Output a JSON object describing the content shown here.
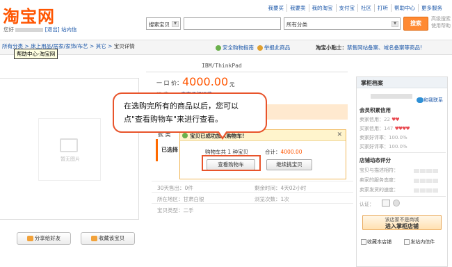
{
  "header": {
    "logo": "淘宝网",
    "nav": [
      "我要买",
      "我要卖",
      "我的淘宝",
      "支付宝",
      "社区",
      "打听",
      "帮助中心",
      "更多服务"
    ],
    "greeting": "您好",
    "logout": "[退出]",
    "messages": "站内信"
  },
  "search": {
    "scope": "搜索宝贝",
    "category": "所有分类",
    "button": "搜索",
    "advanced": "高级搜索\n使用帮助"
  },
  "breadcrumb": {
    "items": [
      "所有分类",
      "床上用品/居家/家饰/布艺",
      "其它",
      "宝贝详情"
    ],
    "tooltip": "帮助中心-淘宝网"
  },
  "guide": {
    "safe": "安全购物指南",
    "report": "举报此商品"
  },
  "tips": {
    "label": "淘宝小贴士：",
    "text": "禁售网站备案、域名备案等商品!"
  },
  "product": {
    "title": "IBM/ThinkPad",
    "price_label": "一 口 价：",
    "price": "4000.00",
    "unit": "元",
    "freight_label": "运      费：",
    "freight_value": "卖家承担运费",
    "kuan_label": "款  类",
    "selected_label": "已选择"
  },
  "stats": {
    "sales": "30天售出：0件",
    "remaining": "剩余时间：4天02小时",
    "location": "所在地区：甘肃白银",
    "views": "浏览次数：1次",
    "type": "宝贝类型：二手"
  },
  "popup": {
    "title": "宝贝已成功加入购物车!",
    "count": "购物车共 1 种宝贝",
    "total_label": "合计：",
    "total": "4000.00",
    "view_cart": "查看购物车",
    "continue": "继续挑宝贝",
    "close": "✕"
  },
  "callout": {
    "line1": "在选购完所有的商品以后，您可以",
    "line2": "点\"查看购物车\"来进行查看。"
  },
  "image": {
    "noimg": "暂无图片"
  },
  "actions": {
    "share": "分享给好友",
    "favorite": "收藏该宝贝"
  },
  "seller": {
    "title": "掌柜档案",
    "wangwang": "和我联系",
    "credit_title": "会员积累信用",
    "seller_credit_label": "卖家信用：",
    "seller_credit_value": "22",
    "buyer_credit_label": "买家信用：",
    "buyer_credit_value": "147",
    "seller_rate_label": "卖家好评率：",
    "seller_rate_value": "100.0%",
    "buyer_rate_label": "买家好评率：",
    "buyer_rate_value": "100.0%",
    "dsr_title": "店铺动态评分",
    "dsr_1": "宝贝与描述相符：",
    "dsr_2": "卖家的服务态度：",
    "dsr_3": "卖家发货的速度：",
    "cert_label": "认证：",
    "shop_btn_top": "该店家不是商城",
    "shop_btn": "进入掌柜店铺",
    "fav_shop": "收藏本店铺",
    "send_msg": "发站内信件"
  },
  "colors": {
    "brand": "#ff5500",
    "link": "#1a56a8",
    "callout_border": "#e8542b",
    "popup_border": "#f0b85a"
  }
}
